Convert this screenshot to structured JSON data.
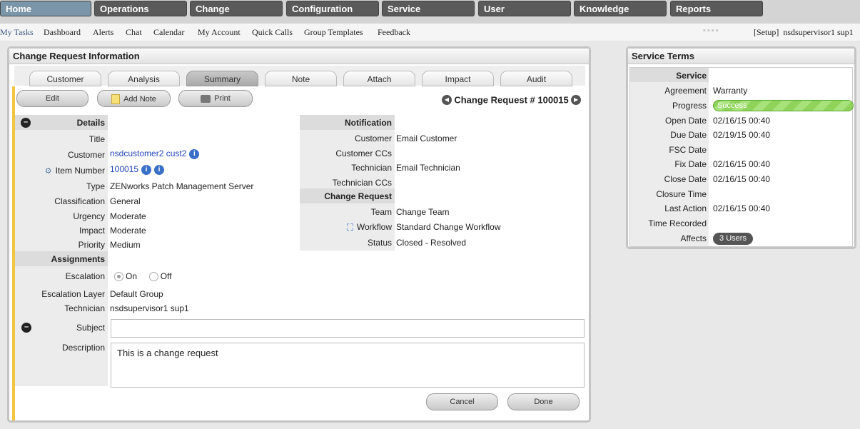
{
  "topnav": {
    "tabs": [
      "Home",
      "Operations",
      "Change",
      "Configuration",
      "Service",
      "User",
      "Knowledge",
      "Reports"
    ]
  },
  "subnav": {
    "links": [
      "My Tasks",
      "Dashboard",
      "Alerts",
      "Chat",
      "Calendar",
      "My Account",
      "Quick Calls",
      "Group Templates",
      "Feedback"
    ],
    "setup": "[Setup]",
    "user": "nsdsupervisor1 sup1"
  },
  "crpanel": {
    "title": "Change Request Information",
    "tabs": [
      "Customer",
      "Analysis",
      "Summary",
      "Note",
      "Attach",
      "Impact",
      "Audit"
    ],
    "active_tab": "Summary",
    "toolbar": {
      "edit": "Edit",
      "add_note": "Add Note",
      "print": "Print",
      "request_title": "Change Request # 100015"
    },
    "details": {
      "header": "Details",
      "title_label": "Title",
      "title_value": "",
      "customer_label": "Customer",
      "customer_value": "nsdcustomer2 cust2",
      "item_label": "Item Number",
      "item_value": "100015",
      "type_label": "Type",
      "type_value": "ZENworks Patch Management Server",
      "classification_label": "Classification",
      "classification_value": "General",
      "urgency_label": "Urgency",
      "urgency_value": "Moderate",
      "impact_label": "Impact",
      "impact_value": "Moderate",
      "priority_label": "Priority",
      "priority_value": "Medium"
    },
    "assignments": {
      "header": "Assignments",
      "escalation_label": "Escalation",
      "escalation_on": "On",
      "escalation_off": "Off",
      "layer_label": "Escalation Layer",
      "layer_value": "Default Group",
      "technician_label": "Technician",
      "technician_value": "nsdsupervisor1 sup1"
    },
    "notification": {
      "header": "Notification",
      "customer_label": "Customer",
      "customer_value": "Email  Customer",
      "customer_ccs_label": "Customer CCs",
      "technician_label": "Technician",
      "technician_value": "Email  Technician",
      "technician_ccs_label": "Technician CCs"
    },
    "change_request": {
      "header": "Change Request",
      "team_label": "Team",
      "team_value": "Change Team",
      "workflow_label": "Workflow",
      "workflow_value": "Standard Change Workflow",
      "status_label": "Status",
      "status_value": "Closed - Resolved"
    },
    "subject_label": "Subject",
    "subject_value": "",
    "description_label": "Description",
    "description_value": "This is a change request",
    "cancel": "Cancel",
    "done": "Done"
  },
  "stpanel": {
    "title": "Service Terms",
    "service_label": "Service",
    "agreement_label": "Agreement",
    "agreement_value": "Warranty",
    "progress_label": "Progress",
    "progress_value": "Success",
    "open_label": "Open Date",
    "open_value": "02/16/15 00:40",
    "due_label": "Due Date",
    "due_value": "02/19/15 00:40",
    "fsc_label": "FSC Date",
    "fix_label": "Fix Date",
    "fix_value": "02/16/15 00:40",
    "close_label": "Close Date",
    "close_value": "02/16/15 00:40",
    "closure_label": "Closure Time",
    "last_label": "Last Action",
    "last_value": "02/16/15 00:40",
    "recorded_label": "Time Recorded",
    "affects_label": "Affects",
    "affects_value": "3 Users"
  },
  "colors": {
    "accent_bar": "#f2c640",
    "active_tab": "#7a96a8",
    "progress": "#8fd35a",
    "link": "#2244bb"
  }
}
